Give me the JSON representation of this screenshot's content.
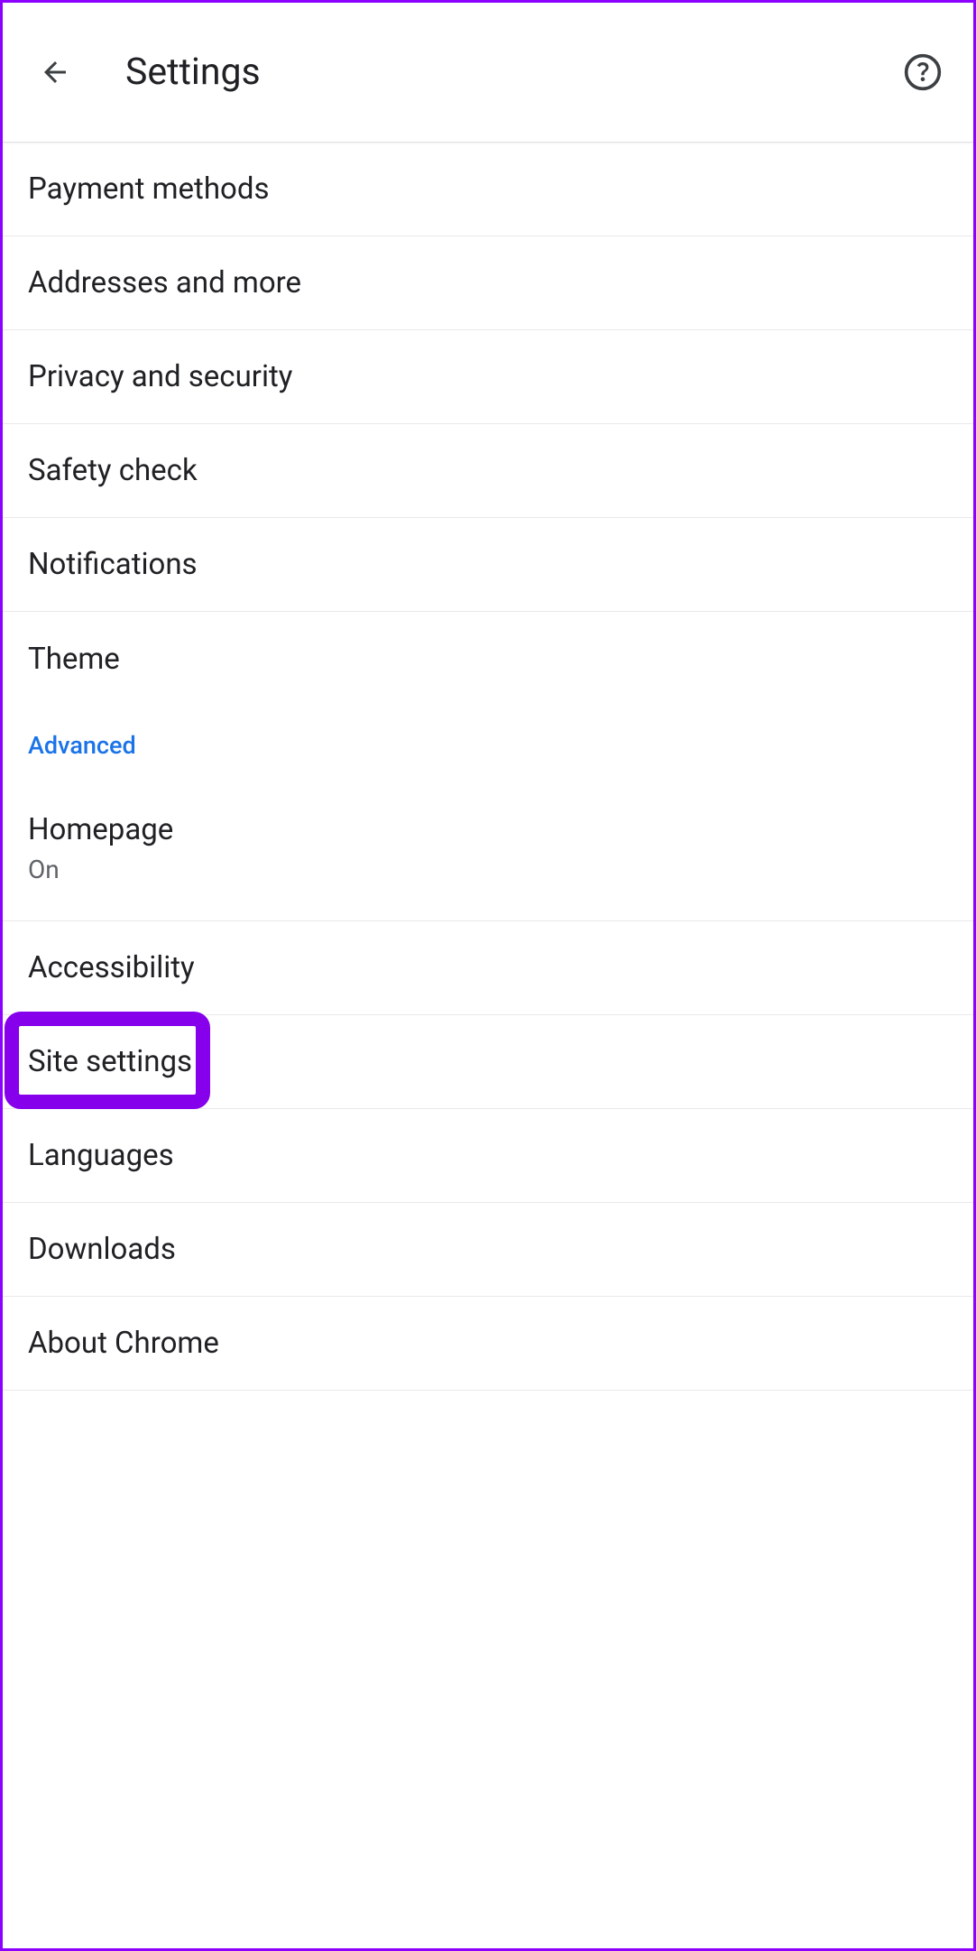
{
  "header": {
    "title": "Settings"
  },
  "basics_section": {
    "items": [
      {
        "label": "Payment methods"
      },
      {
        "label": "Addresses and more"
      },
      {
        "label": "Privacy and security"
      },
      {
        "label": "Safety check"
      },
      {
        "label": "Notifications"
      },
      {
        "label": "Theme"
      }
    ]
  },
  "advanced_section": {
    "header": "Advanced",
    "items": [
      {
        "label": "Homepage",
        "sublabel": "On"
      },
      {
        "label": "Accessibility"
      },
      {
        "label": "Site settings"
      },
      {
        "label": "Languages"
      },
      {
        "label": "Downloads"
      },
      {
        "label": "About Chrome"
      }
    ]
  }
}
